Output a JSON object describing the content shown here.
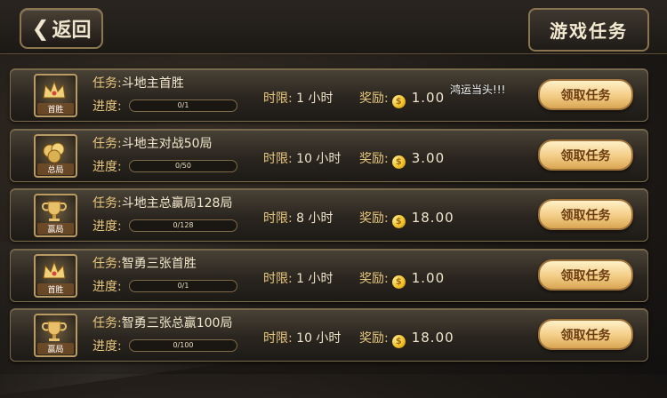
{
  "header": {
    "back_label": "返回",
    "title": "游戏任务"
  },
  "marquee": "鸿运当头!!!",
  "labels": {
    "task": "任务:",
    "progress": "进度:",
    "time_limit": "时限:",
    "reward": "奖励:",
    "claim": "领取任务"
  },
  "tasks": [
    {
      "name": "斗地主首胜",
      "progress": "0/1",
      "limit": "1 小时",
      "reward": "1.00",
      "icon": "crown-icon",
      "tag": "首胜"
    },
    {
      "name": "斗地主对战50局",
      "progress": "0/50",
      "limit": "10 小时",
      "reward": "3.00",
      "icon": "coin-bag-icon",
      "tag": "总局"
    },
    {
      "name": "斗地主总赢局128局",
      "progress": "0/128",
      "limit": "8 小时",
      "reward": "18.00",
      "icon": "trophy-icon",
      "tag": "赢局"
    },
    {
      "name": "智勇三张首胜",
      "progress": "0/1",
      "limit": "1 小时",
      "reward": "1.00",
      "icon": "crown-icon",
      "tag": "首胜"
    },
    {
      "name": "智勇三张总赢100局",
      "progress": "0/100",
      "limit": "10 小时",
      "reward": "18.00",
      "icon": "trophy-icon",
      "tag": "赢局"
    }
  ],
  "colors": {
    "accent_gold": "#e8c77e",
    "button_gold": "#f3cd86",
    "background": "#1e1a16"
  }
}
